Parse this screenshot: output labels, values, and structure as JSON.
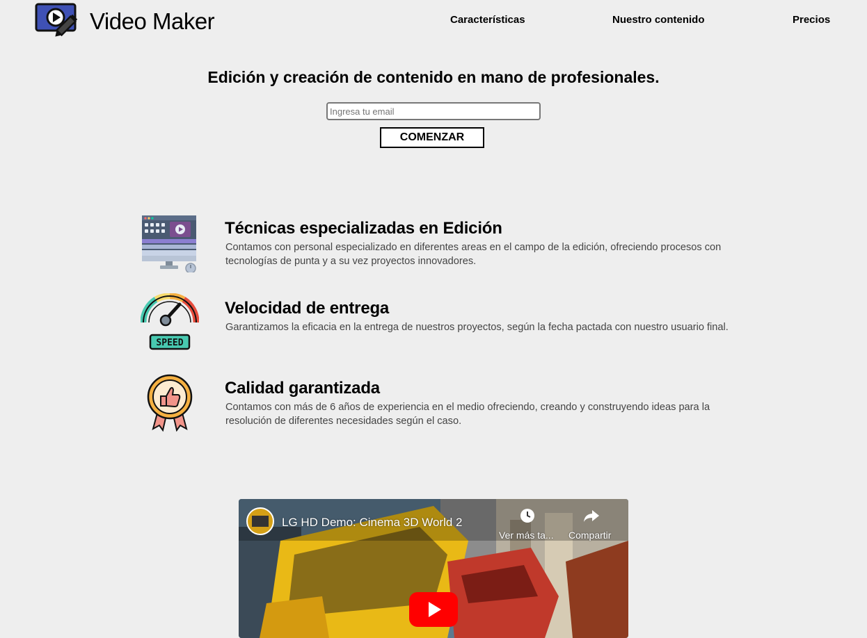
{
  "header": {
    "brand": "Video Maker",
    "nav": [
      "Características",
      "Nuestro contenido",
      "Precios"
    ]
  },
  "hero": {
    "title": "Edición y creación de contenido en mano de profesionales.",
    "email_placeholder": "Ingresa tu email",
    "button_label": "COMENZAR"
  },
  "features": [
    {
      "icon": "video-editing-monitor-icon",
      "title": "Técnicas especializadas en Edición",
      "text": "Contamos con personal especializado en diferentes areas en el campo de la edición, ofreciendo procesos con tecnologías de punta y a su vez proyectos innovadores."
    },
    {
      "icon": "speedometer-icon",
      "icon_label": "SPEED",
      "title": "Velocidad de entrega",
      "text": "Garantizamos la eficacia en la entrega de nuestros proyectos, según la fecha pactada con nuestro usuario final."
    },
    {
      "icon": "quality-badge-thumbs-up-icon",
      "title": "Calidad garantizada",
      "text": "Contamos con más de 6 años de experiencia en el medio ofreciendo, creando y construyendo ideas para la resolución de diferentes necesidades según el caso."
    }
  ],
  "video": {
    "title": "LG HD Demo: Cinema 3D World 2",
    "watch_later": "Ver más ta...",
    "share": "Compartir"
  },
  "colors": {
    "background": "#eeeeee",
    "logo_blue": "#3f51b5",
    "youtube_red": "#ff0000"
  }
}
